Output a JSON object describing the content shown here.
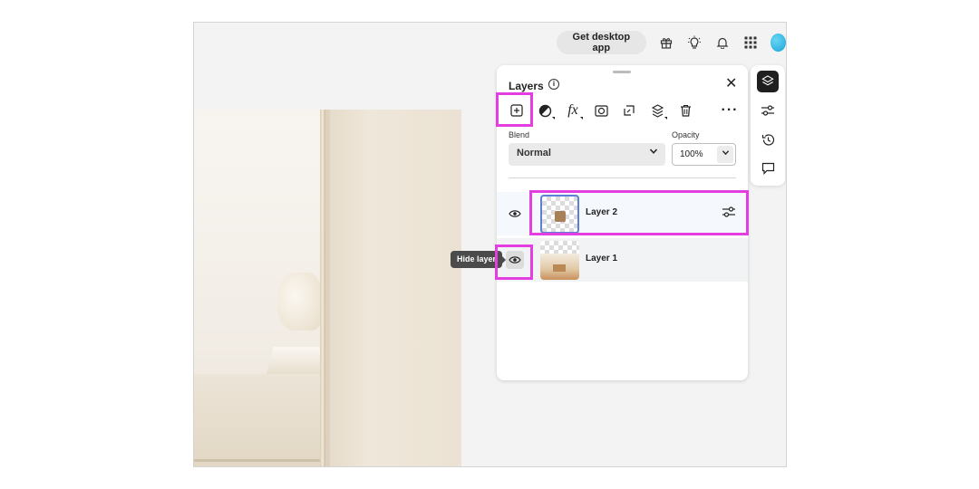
{
  "topbar": {
    "desktop_button": "Get desktop app",
    "icons": [
      "gift-icon",
      "lightbulb-icon",
      "bell-icon",
      "apps-grid-icon",
      "avatar"
    ]
  },
  "layers_panel": {
    "title": "Layers",
    "toolbar": [
      "add-layer",
      "adjustment-layer",
      "fx-effects",
      "mask",
      "clipping-mask",
      "layer-options",
      "delete",
      "more"
    ],
    "blend_label": "Blend",
    "blend_value": "Normal",
    "opacity_label": "Opacity",
    "opacity_value": "100%",
    "layers": [
      {
        "name": "Layer 2",
        "selected": true
      },
      {
        "name": "Layer 1",
        "selected": false
      }
    ],
    "tooltip": "Hide layer"
  },
  "rail": [
    "layers-icon",
    "adjustments-icon",
    "history-icon",
    "comments-icon"
  ],
  "colors": {
    "highlight": "#e23ee0",
    "selection": "#5c7fd8",
    "avatar": "#1aa5d8"
  }
}
